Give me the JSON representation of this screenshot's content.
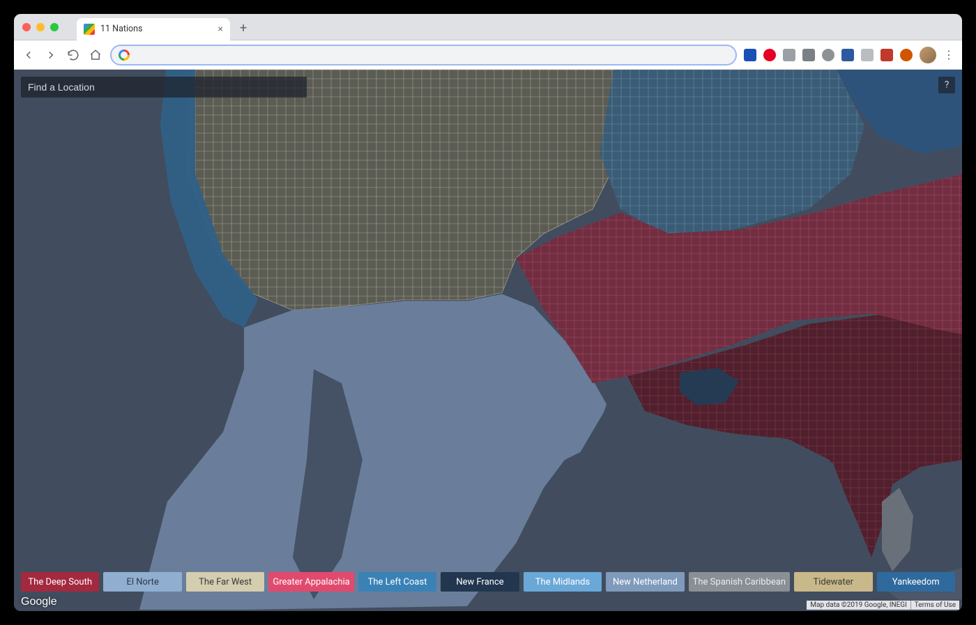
{
  "browser": {
    "tab_title": "11 Nations",
    "url_value": "",
    "extensions_colors": [
      "#1a4fb4",
      "#e60023",
      "#9aa0a6",
      "#7b7f86",
      "#8e9297",
      "#2c5aa0",
      "#b9bcc1",
      "#c0392b",
      "#d35400"
    ]
  },
  "map": {
    "search_placeholder": "Find a Location",
    "help_label": "?",
    "google_label": "Google",
    "attribution_data": "Map data ©2019 Google, INEGI",
    "attribution_terms": "Terms of Use"
  },
  "legend": [
    {
      "label": "The Deep South",
      "bg": "#a3293f",
      "fg": "#ffffff"
    },
    {
      "label": "El Norte",
      "bg": "#90aed0",
      "fg": "#2d3748"
    },
    {
      "label": "The Far West",
      "bg": "#d4cdb0",
      "fg": "#3a3a3a"
    },
    {
      "label": "Greater Appalachia",
      "bg": "#e14a6e",
      "fg": "#ffffff"
    },
    {
      "label": "The Left Coast",
      "bg": "#3a82b6",
      "fg": "#ffffff"
    },
    {
      "label": "New France",
      "bg": "#22364f",
      "fg": "#ffffff"
    },
    {
      "label": "The Midlands",
      "bg": "#6aa8d8",
      "fg": "#ffffff"
    },
    {
      "label": "New Netherland",
      "bg": "#7f9abb",
      "fg": "#ffffff"
    },
    {
      "label": "The Spanish Caribbean",
      "bg": "#8a8f96",
      "fg": "#e9ebee"
    },
    {
      "label": "Tidewater",
      "bg": "#c9b889",
      "fg": "#3a3a3a"
    },
    {
      "label": "Yankeedom",
      "bg": "#2f6a9e",
      "fg": "#ffffff"
    }
  ],
  "map_regions": {
    "ocean": "#4a5768",
    "far_west": "#b2b09a",
    "left_coast": "#356f9a",
    "el_norte": "#7e97b7",
    "midlands": "#5c93be",
    "appalachia": "#cc4a6a",
    "deep_south": "#8f2f43",
    "new_france": "#28415c",
    "yankeedom": "#2f5f8c",
    "spanish_caribbean": "#7c828a",
    "county_border": "#d8d2b8"
  }
}
